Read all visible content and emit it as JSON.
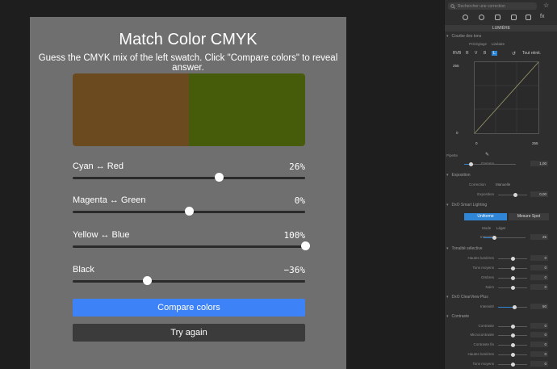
{
  "game": {
    "title": "Match Color CMYK",
    "subtitle": "Guess the CMYK mix of the left swatch. Click \"Compare colors\" to reveal answer.",
    "swatch_target": "#6b4a1f",
    "swatch_guess": "#465c0a",
    "sliders": [
      {
        "label": "Cyan ↔ Red",
        "value": "26%",
        "level": 0.63
      },
      {
        "label": "Magenta ↔ Green",
        "value": "0%",
        "level": 0.5
      },
      {
        "label": "Yellow ↔ Blue",
        "value": "100%",
        "level": 1.0
      },
      {
        "label": "Black",
        "value": "−36%",
        "level": 0.32
      }
    ],
    "compare_label": "Compare colors",
    "try_again_label": "Try again",
    "accent": "#3d82f6"
  },
  "panel": {
    "search_placeholder": "Rechercher une correction",
    "section_title": "LUMIÈRE",
    "curve": {
      "title": "Courbe des tons",
      "template_label": "Préréglage",
      "template_value": "Linéaire",
      "channels": [
        "RVB",
        "R",
        "V",
        "B",
        "L"
      ],
      "reset_label": "Tout réinit.",
      "top_value": "255",
      "bottom_value": "0",
      "in_min": "0",
      "in_max": "255",
      "pipette_label": "Pipette",
      "gamma_label": "Gamma",
      "gamma_value": "1,00"
    },
    "exposure": {
      "title": "Exposition",
      "correction_label": "Correction",
      "correction_value": "Manuelle",
      "exposure_label": "Exposition",
      "exposure_value": "0,00"
    },
    "smart_lighting": {
      "title": "DxO Smart Lighting",
      "mode_uniform": "Uniforme",
      "mode_spot": "Mesure Spot",
      "mode_label": "Mode",
      "mode_value": "Léger",
      "intensity_label": "Intensité",
      "intensity_value": "25"
    },
    "selective_tone": {
      "title": "Tonalité sélective",
      "rows": [
        {
          "label": "Hautes lumières",
          "value": "0"
        },
        {
          "label": "Tons moyens",
          "value": "0"
        },
        {
          "label": "Ombres",
          "value": "0"
        },
        {
          "label": "Noirs",
          "value": "0"
        }
      ]
    },
    "clearview": {
      "title": "DxO ClearView Plus",
      "intensity_label": "Intensité",
      "intensity_value": "50"
    },
    "contrast": {
      "title": "Contraste",
      "rows": [
        {
          "label": "Contraste",
          "value": "0"
        },
        {
          "label": "Microcontraste",
          "value": "0"
        },
        {
          "label": "Contraste fin",
          "value": "0"
        },
        {
          "label": "Hautes lumières",
          "value": "0"
        },
        {
          "label": "Tons moyens",
          "value": "0"
        }
      ]
    }
  }
}
